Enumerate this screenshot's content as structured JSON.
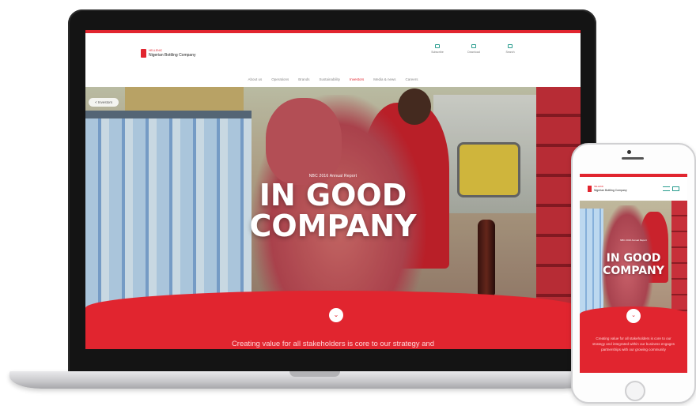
{
  "desktop": {
    "logo": {
      "small": "HELLENIC",
      "name": "Nigerian Bottling Company"
    },
    "tools": [
      {
        "icon": "mail-icon",
        "label": "Subscribe"
      },
      {
        "icon": "share-icon",
        "label": "Download"
      },
      {
        "icon": "search-icon",
        "label": "Search"
      }
    ],
    "nav": [
      {
        "label": "About us",
        "active": false
      },
      {
        "label": "Operations",
        "active": false
      },
      {
        "label": "Brands",
        "active": false
      },
      {
        "label": "Sustainability",
        "active": false
      },
      {
        "label": "Investors",
        "active": true
      },
      {
        "label": "Media & news",
        "active": false
      },
      {
        "label": "Careers",
        "active": false
      }
    ],
    "back_label": "< Investors",
    "hero": {
      "kicker": "NBC 2016 Annual Report",
      "title_line1": "IN GOOD",
      "title_line2": "COMPANY"
    },
    "scroll_glyph": "⌄",
    "caption": "Creating value for all stakeholders is core to our strategy and"
  },
  "mobile": {
    "logo": {
      "small": "HELLENIC",
      "name": "Nigerian Bottling Company"
    },
    "hero": {
      "kicker": "NBC 2016 Annual Report",
      "title_line1": "IN GOOD",
      "title_line2": "COMPANY"
    },
    "scroll_glyph": "⌄",
    "caption": "Creating value for all stakeholders is core to our strategy and integrated within our business engages partnerships with our growing community"
  },
  "colors": {
    "brand_red": "#e1252f",
    "accent_teal": "#2a9d8f",
    "device_dark": "#141414"
  }
}
